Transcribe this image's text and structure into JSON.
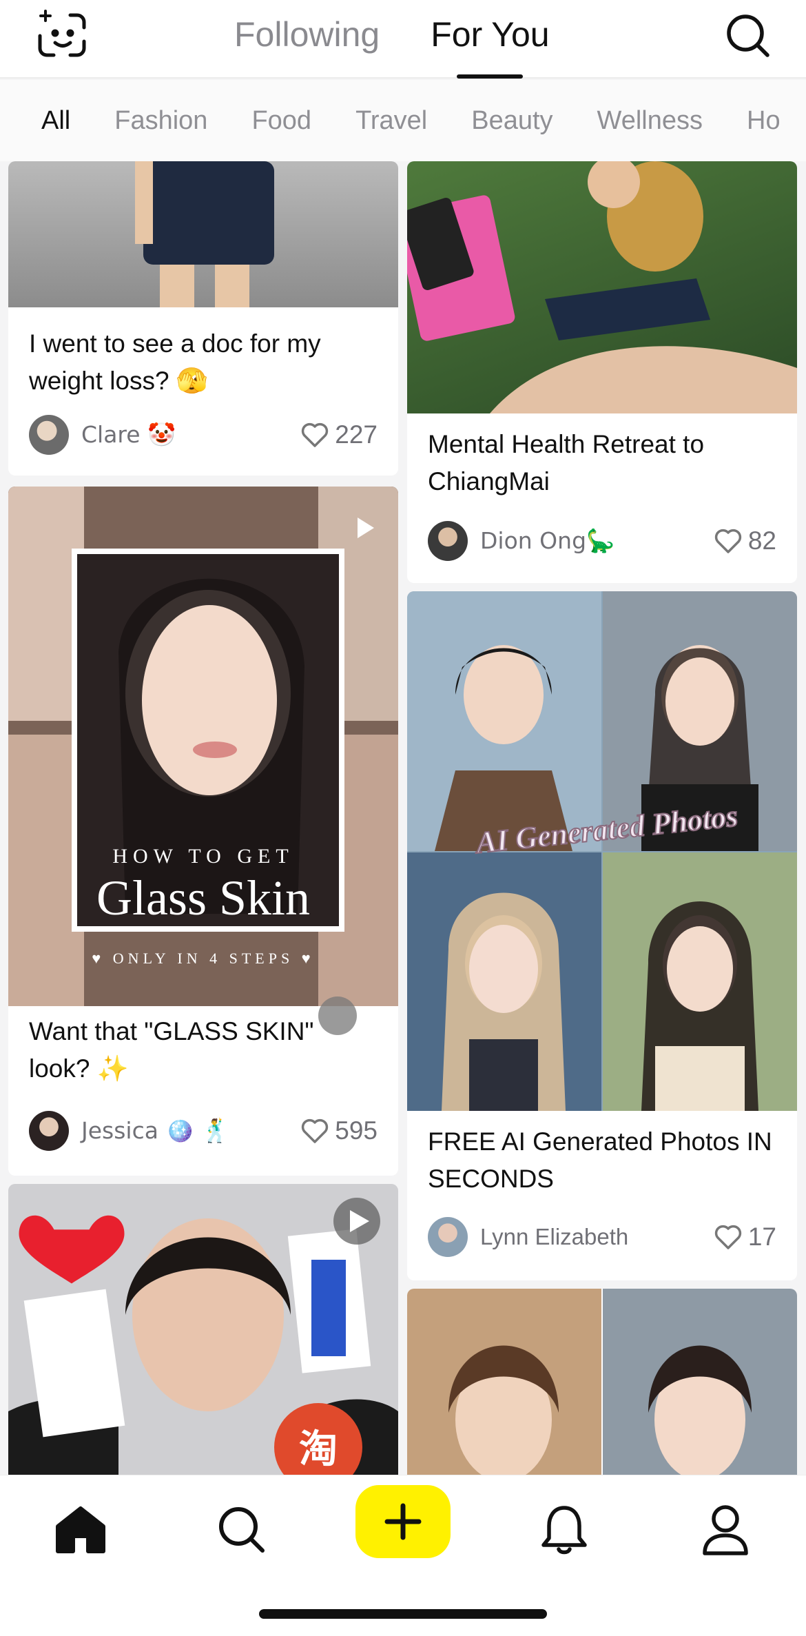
{
  "header": {
    "tabs": [
      {
        "label": "Following",
        "active": false
      },
      {
        "label": "For You",
        "active": true
      }
    ],
    "left_icon": "face-scan-sparkle-icon",
    "right_icon": "search-icon"
  },
  "categories": [
    {
      "label": "All",
      "active": true
    },
    {
      "label": "Fashion",
      "active": false
    },
    {
      "label": "Food",
      "active": false
    },
    {
      "label": "Travel",
      "active": false
    },
    {
      "label": "Beauty",
      "active": false
    },
    {
      "label": "Wellness",
      "active": false
    },
    {
      "label": "Ho",
      "active": false
    }
  ],
  "posts": [
    {
      "title": "I went to see a doc for my weight loss? 🫣",
      "author": "Clare 🤡",
      "likes": "227"
    },
    {
      "title": "Mental Health Retreat to ChiangMai",
      "author": "Dion Ong🦕",
      "likes": "82"
    },
    {
      "title": "Want that \"GLASS SKIN\" look? ✨",
      "author": "Jessica 🪩 🕺",
      "likes": "595",
      "overlay": {
        "line1": "HOW TO GET",
        "line2": "Glass Skin",
        "line3": "♥ ONLY IN 4 STEPS ♥"
      }
    },
    {
      "title": "FREE AI Generated Photos IN SECONDS",
      "author": "Lynn Elizabeth",
      "likes": "17",
      "overlay": {
        "text": "AI Generated Photos"
      }
    },
    {
      "title": "",
      "author": "",
      "likes": "",
      "overlay": {
        "badge": "淘"
      }
    },
    {
      "title": "",
      "author": "",
      "likes": ""
    }
  ],
  "bottom_nav": [
    {
      "icon": "home-icon",
      "active": true
    },
    {
      "icon": "search-icon",
      "active": false
    },
    {
      "icon": "plus-icon",
      "active": false
    },
    {
      "icon": "bell-icon",
      "active": false
    },
    {
      "icon": "profile-icon",
      "active": false
    }
  ],
  "colors": {
    "accent": "#fff100",
    "text": "#111111",
    "muted": "#8a8a8f"
  }
}
